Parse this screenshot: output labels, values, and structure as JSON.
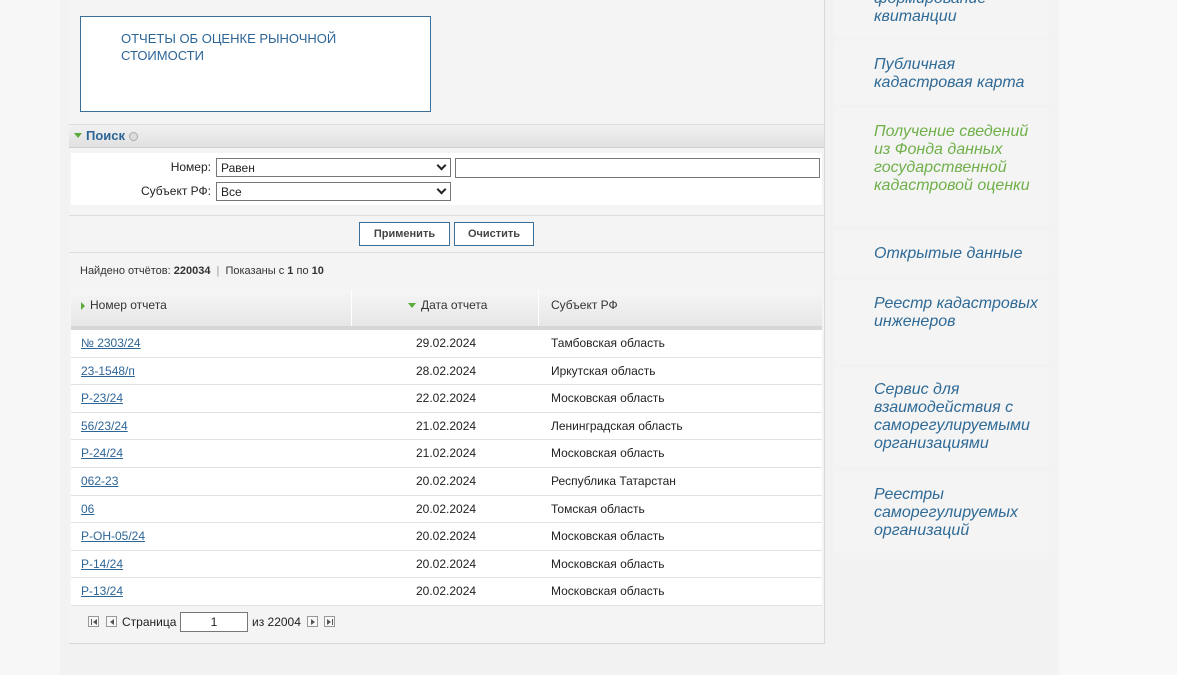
{
  "report_link": "ОТЧЕТЫ ОБ ОЦЕНКЕ РЫНОЧНОЙ СТОИМОСТИ",
  "search": {
    "title": "Поиск",
    "number_label": "Номер:",
    "number_operator": "Равен",
    "number_value": "",
    "subject_label": "Субъект РФ:",
    "subject_value": "Все",
    "apply_label": "Применить",
    "clear_label": "Очистить"
  },
  "results": {
    "found_label": "Найдено отчётов:",
    "found_count": "220034",
    "shown_label": "Показаны с",
    "shown_from": "1",
    "shown_to_label": "по",
    "shown_to": "10"
  },
  "table": {
    "headers": [
      "Номер отчета",
      "Дата отчета",
      "Субъект РФ"
    ],
    "rows": [
      [
        "№ 2303/24",
        "29.02.2024",
        "Тамбовская область"
      ],
      [
        "23-1548/п",
        "28.02.2024",
        "Иркутская область"
      ],
      [
        "Р-23/24",
        "22.02.2024",
        "Московская область"
      ],
      [
        "56/23/24",
        "21.02.2024",
        "Ленинградская область"
      ],
      [
        "Р-24/24",
        "21.02.2024",
        "Московская область"
      ],
      [
        "062-23",
        "20.02.2024",
        "Республика Татарстан"
      ],
      [
        "06",
        "20.02.2024",
        "Томская область"
      ],
      [
        "Р-ОН-05/24",
        "20.02.2024",
        "Московская область"
      ],
      [
        "Р-14/24",
        "20.02.2024",
        "Московская область"
      ],
      [
        "Р-13/24",
        "20.02.2024",
        "Московская область"
      ]
    ]
  },
  "pager": {
    "page_label": "Страница",
    "page_value": "1",
    "of_label": "из 22004"
  },
  "sidebar": {
    "items": [
      {
        "label": "формирование квитанции"
      },
      {
        "label": "Публичная кадастровая карта"
      },
      {
        "label": "Получение сведений из Фонда данных государственной кадастровой оценки"
      },
      {
        "label": "Открытые данные"
      },
      {
        "label": "Реестр кадастровых инженеров"
      },
      {
        "label": "Сервис для взаимодействия с саморегулируемыми организациями"
      },
      {
        "label": "Реестры саморегулируемых организаций"
      }
    ]
  },
  "colors": {
    "link": "#2d6596",
    "accent_green": "#6fb04a"
  }
}
